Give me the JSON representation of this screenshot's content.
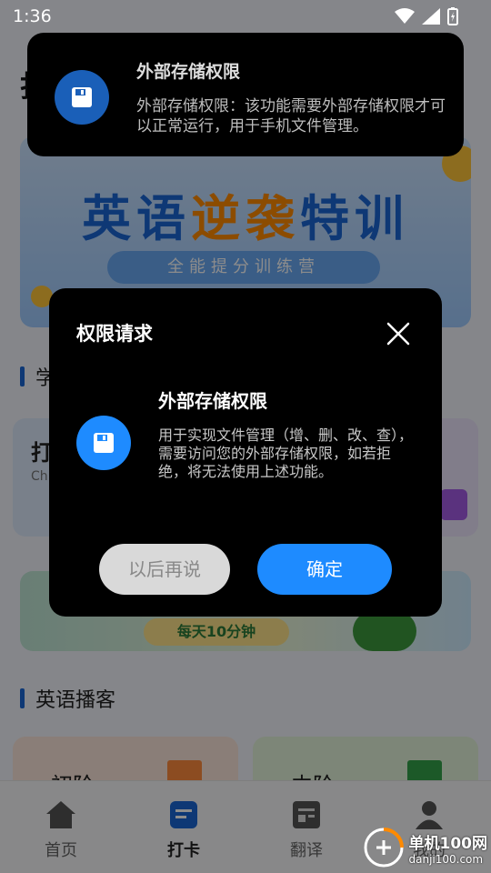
{
  "status_bar": {
    "time": "1:36"
  },
  "background_page": {
    "title_fragment": "打",
    "banner": {
      "title_part1": "英语",
      "title_part2": "逆袭",
      "title_part3": "特训",
      "subtitle": "全能提分训练营"
    },
    "section1_fragment": "学",
    "card_left": {
      "title_fragment": "打",
      "subtitle_fragment": "Ch"
    },
    "promo_tag": "每天10分钟",
    "section2_title": "英语播客",
    "podcast_cards": [
      {
        "label": "初阶"
      },
      {
        "label": "中阶"
      }
    ],
    "tabs": [
      {
        "label": "首页",
        "icon": "home-icon",
        "active": false
      },
      {
        "label": "打卡",
        "icon": "checkin-icon",
        "active": true
      },
      {
        "label": "翻译",
        "icon": "translate-icon",
        "active": false
      },
      {
        "label": "我的",
        "icon": "profile-icon",
        "active": false
      }
    ]
  },
  "toast": {
    "icon": "storage-icon",
    "title": "外部存储权限",
    "description": "外部存储权限：该功能需要外部存储权限才可以正常运行，用于手机文件管理。"
  },
  "dialog": {
    "title": "权限请求",
    "close_icon": "close-icon",
    "permission_icon": "storage-icon",
    "permission_title": "外部存储权限",
    "permission_description": "用于实现文件管理（增、删、改、查），需要访问您的外部存储权限，如若拒绝，将无法使用上述功能。",
    "later_label": "以后再说",
    "confirm_label": "确定"
  },
  "watermark": {
    "name": "单机100网",
    "url": "danji100.com"
  },
  "colors": {
    "primary": "#1e8bff",
    "dialog_bg": "#000000",
    "toast_icon_bg": "#1a5fb8"
  }
}
